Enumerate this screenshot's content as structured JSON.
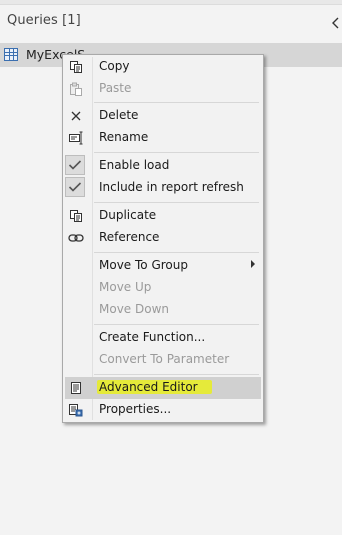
{
  "pane": {
    "title": "Queries [1]",
    "query_name": "MyExcelS"
  },
  "menu": {
    "copy": "Copy",
    "paste": "Paste",
    "delete": "Delete",
    "rename": "Rename",
    "enable_load": "Enable load",
    "include_refresh": "Include in report refresh",
    "duplicate": "Duplicate",
    "reference": "Reference",
    "move_to_group": "Move To Group",
    "move_up": "Move Up",
    "move_down": "Move Down",
    "create_function": "Create Function...",
    "convert_to_parameter": "Convert To Parameter",
    "advanced_editor": "Advanced Editor",
    "properties": "Properties..."
  },
  "colors": {
    "highlight_marker": "#e5ea3a",
    "table_icon": "#3b6fb0"
  }
}
